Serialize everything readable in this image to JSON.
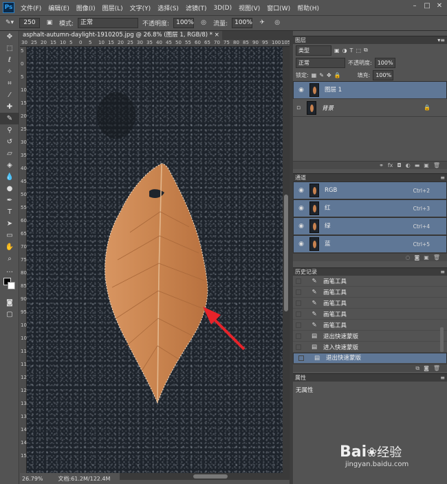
{
  "app": {
    "logo": "Ps"
  },
  "menubar": {
    "items": [
      "文件(F)",
      "编辑(E)",
      "图像(I)",
      "图层(L)",
      "文字(Y)",
      "选择(S)",
      "滤镜(T)",
      "3D(D)",
      "视图(V)",
      "窗口(W)",
      "帮助(H)"
    ]
  },
  "options": {
    "brush_size": "250",
    "mode_label": "模式:",
    "mode_value": "正常",
    "opacity_label": "不透明度:",
    "opacity_value": "100%",
    "flow_label": "流量:",
    "flow_value": "100%"
  },
  "document": {
    "tab_title": "asphalt-autumn-daylight-1910205.jpg @ 26.8% (图层 1, RGB/8) *",
    "zoom": "26.79%",
    "doc_size": "文档:61.2M/122.4M",
    "ruler_top": [
      "30",
      "25",
      "20",
      "15",
      "10",
      "5",
      "0",
      "5",
      "10",
      "15",
      "20",
      "25",
      "30",
      "35",
      "40",
      "45",
      "50",
      "55",
      "60",
      "65",
      "70",
      "75",
      "80",
      "85",
      "90",
      "95",
      "100",
      "105"
    ],
    "ruler_left": [
      "5",
      "0",
      "5",
      "10",
      "15",
      "20",
      "25",
      "30",
      "35",
      "40",
      "45",
      "50",
      "55",
      "60",
      "65",
      "70",
      "75",
      "80",
      "85",
      "90",
      "95",
      "100",
      "105",
      "110",
      "115",
      "120",
      "125",
      "130",
      "135",
      "140",
      "145",
      "150"
    ]
  },
  "layers": {
    "title": "图层",
    "filter": "类型",
    "blend": "正常",
    "opacity_label": "不透明度:",
    "opacity_value": "100%",
    "lock_label": "锁定:",
    "fill_label": "填充:",
    "fill_value": "100%",
    "items": [
      {
        "name": "图层 1",
        "selected": true,
        "visible": true
      },
      {
        "name": "背景",
        "selected": false,
        "visible": false
      }
    ]
  },
  "channels": {
    "title": "通道",
    "items": [
      {
        "name": "RGB",
        "shortcut": "Ctrl+2"
      },
      {
        "name": "红",
        "shortcut": "Ctrl+3"
      },
      {
        "name": "绿",
        "shortcut": "Ctrl+4"
      },
      {
        "name": "蓝",
        "shortcut": "Ctrl+5"
      }
    ]
  },
  "history": {
    "title": "历史记录",
    "items": [
      "画笔工具",
      "画笔工具",
      "画笔工具",
      "画笔工具",
      "画笔工具",
      "退出快速蒙版",
      "进入快速蒙版",
      "退出快速蒙版"
    ]
  },
  "properties": {
    "title": "属性",
    "text": "无属性"
  },
  "watermark": {
    "brand": "Bai",
    "brand2": "经验",
    "url": "jingyan.baidu.com"
  },
  "colors": {
    "accent": "#5f7796",
    "leaf": "#c8824f",
    "arrow": "#e8232a"
  }
}
